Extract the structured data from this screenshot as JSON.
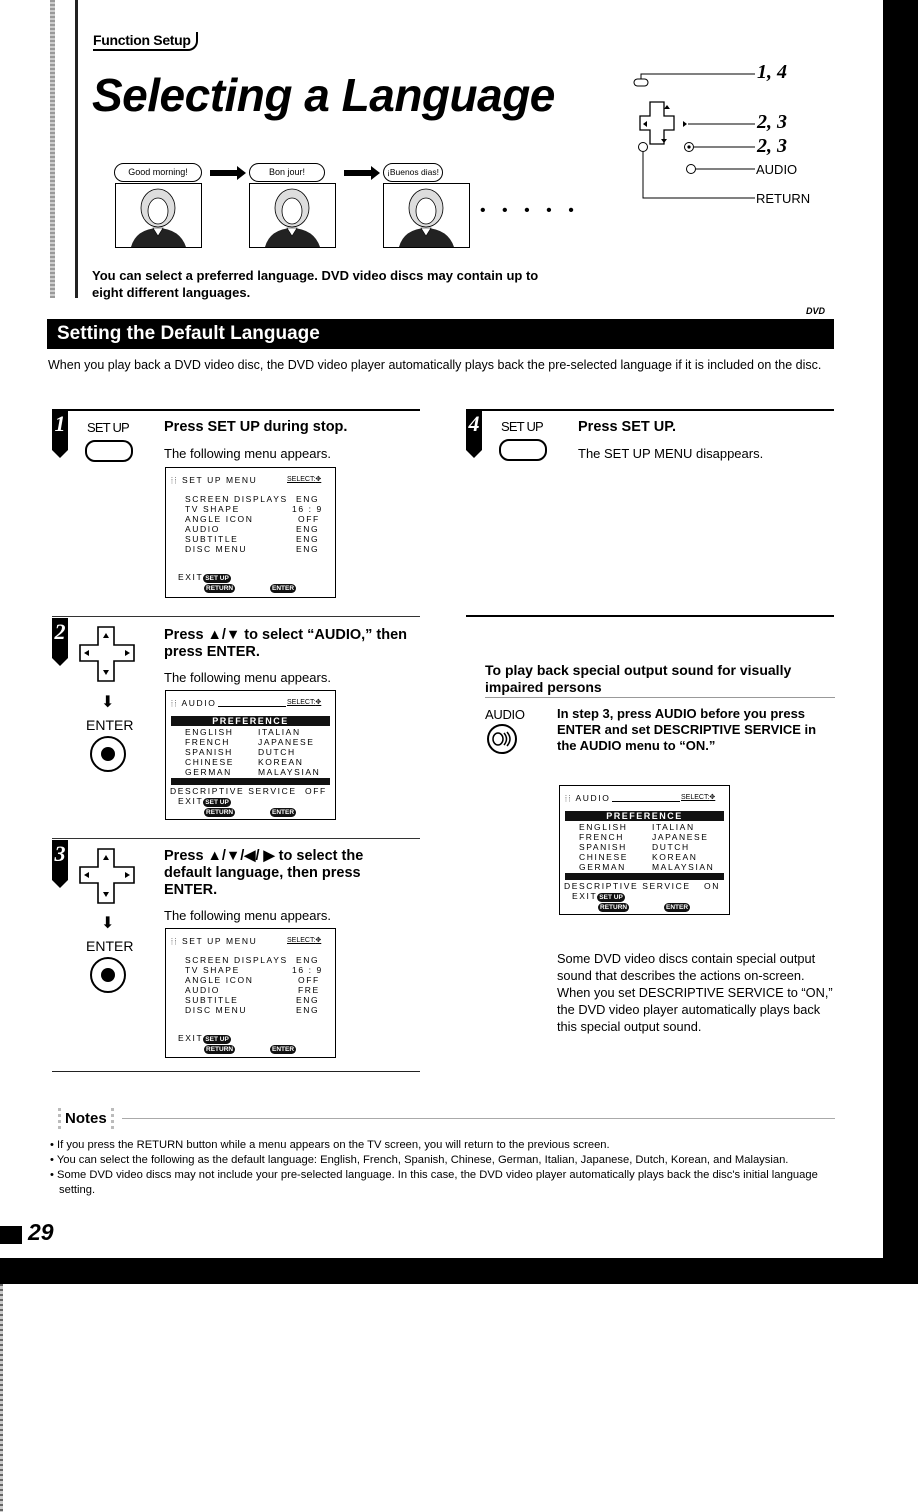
{
  "header": {
    "section_label": "Function Setup",
    "title": "Selecting a Language",
    "intro": "You can select a preferred language. DVD video discs may contain up to eight different languages."
  },
  "illustration": {
    "bubbles": [
      "Good morning!",
      "Bon jour!",
      "¡Buenos dias!"
    ],
    "ellipsis": "• • • • •"
  },
  "remote_diagram": {
    "callouts": [
      {
        "label": "1, 4",
        "target": "setup-button"
      },
      {
        "label": "2, 3",
        "target": "direction-pad"
      },
      {
        "label": "2, 3",
        "target": "enter-button"
      },
      {
        "label": "AUDIO",
        "target": "audio-button"
      },
      {
        "label": "RETURN",
        "target": "return-button"
      }
    ]
  },
  "section": {
    "title": "Setting the Default Language",
    "badge": "DVD",
    "description": "When you play back a DVD video disc, the DVD video player automatically plays back the pre-selected language if it is included on the disc."
  },
  "steps": [
    {
      "number": "1",
      "button_label": "SET UP",
      "heading": "Press SET UP during stop.",
      "sub": "The following menu appears.",
      "menu": {
        "title": "SET UP MENU",
        "select_label": "SELECT:",
        "rows": [
          {
            "item": "SCREEN DISPLAYS",
            "value": "ENG"
          },
          {
            "item": "TV SHAPE",
            "value": "16 : 9"
          },
          {
            "item": "ANGLE ICON",
            "value": "OFF"
          },
          {
            "item": "AUDIO",
            "value": "ENG"
          },
          {
            "item": "SUBTITLE",
            "value": "ENG"
          },
          {
            "item": "DISC MENU",
            "value": "ENG"
          }
        ],
        "exit_label": "EXIT",
        "setup_pill": "SET UP",
        "return_pill": "RETURN",
        "enter_pill": "ENTER"
      }
    },
    {
      "number": "2",
      "button_label": "ENTER",
      "heading": "Press ▲/▼ to select “AUDIO,” then press ENTER.",
      "sub": "The following menu appears.",
      "menu": {
        "title": "AUDIO",
        "select_label": "SELECT:",
        "preference_label": "PREFERENCE",
        "languages_left": [
          "ENGLISH",
          "FRENCH",
          "SPANISH",
          "CHINESE",
          "GERMAN"
        ],
        "languages_right": [
          "ITALIAN",
          "JAPANESE",
          "DUTCH",
          "KOREAN",
          "MALAYSIAN"
        ],
        "descriptive_label": "DESCRIPTIVE SERVICE",
        "descriptive_value": "OFF",
        "exit_label": "EXIT",
        "setup_pill": "SET UP",
        "return_pill": "RETURN",
        "enter_pill": "ENTER"
      }
    },
    {
      "number": "3",
      "button_label": "ENTER",
      "heading": "Press ▲/▼/◀/ ▶ to select the default language, then press ENTER.",
      "sub": "The following menu appears.",
      "menu": {
        "title": "SET UP MENU",
        "select_label": "SELECT:",
        "rows": [
          {
            "item": "SCREEN DISPLAYS",
            "value": "ENG"
          },
          {
            "item": "TV SHAPE",
            "value": "16 : 9"
          },
          {
            "item": "ANGLE ICON",
            "value": "OFF"
          },
          {
            "item": "AUDIO",
            "value": "FRE"
          },
          {
            "item": "SUBTITLE",
            "value": "ENG"
          },
          {
            "item": "DISC MENU",
            "value": "ENG"
          }
        ],
        "exit_label": "EXIT",
        "setup_pill": "SET UP",
        "return_pill": "RETURN",
        "enter_pill": "ENTER"
      }
    },
    {
      "number": "4",
      "button_label": "SET UP",
      "heading": "Press SET UP.",
      "sub": "The SET UP MENU disappears."
    }
  ],
  "visually_impaired": {
    "heading": "To play back special output sound for visually impaired persons",
    "button_label": "AUDIO",
    "instruction": "In step 3, press AUDIO before you press ENTER and set DESCRIPTIVE SERVICE in the AUDIO menu to “ON.”",
    "menu": {
      "title": "AUDIO",
      "select_label": "SELECT:",
      "preference_label": "PREFERENCE",
      "languages_left": [
        "ENGLISH",
        "FRENCH",
        "SPANISH",
        "CHINESE",
        "GERMAN"
      ],
      "languages_right": [
        "ITALIAN",
        "JAPANESE",
        "DUTCH",
        "KOREAN",
        "MALAYSIAN"
      ],
      "descriptive_label": "DESCRIPTIVE SERVICE",
      "descriptive_value": "ON",
      "exit_label": "EXIT",
      "setup_pill": "SET UP",
      "return_pill": "RETURN",
      "enter_pill": "ENTER"
    },
    "explanation": "Some DVD video discs contain special output sound that describes the actions on-screen. When you set DESCRIPTIVE SERVICE to “ON,” the DVD video player automatically plays back this special output sound."
  },
  "notes": {
    "title": "Notes",
    "items": [
      "• If you press the RETURN button while a menu appears on the TV screen, you will return to the previous screen.",
      "• You can select the following as the default language: English, French, Spanish, Chinese, German, Italian, Japanese, Dutch, Korean, and Malaysian.",
      "• Some DVD video discs may not include your pre-selected language. In this case, the DVD video player automatically plays back the disc's initial language setting."
    ]
  },
  "footer": {
    "page_number": "29"
  }
}
